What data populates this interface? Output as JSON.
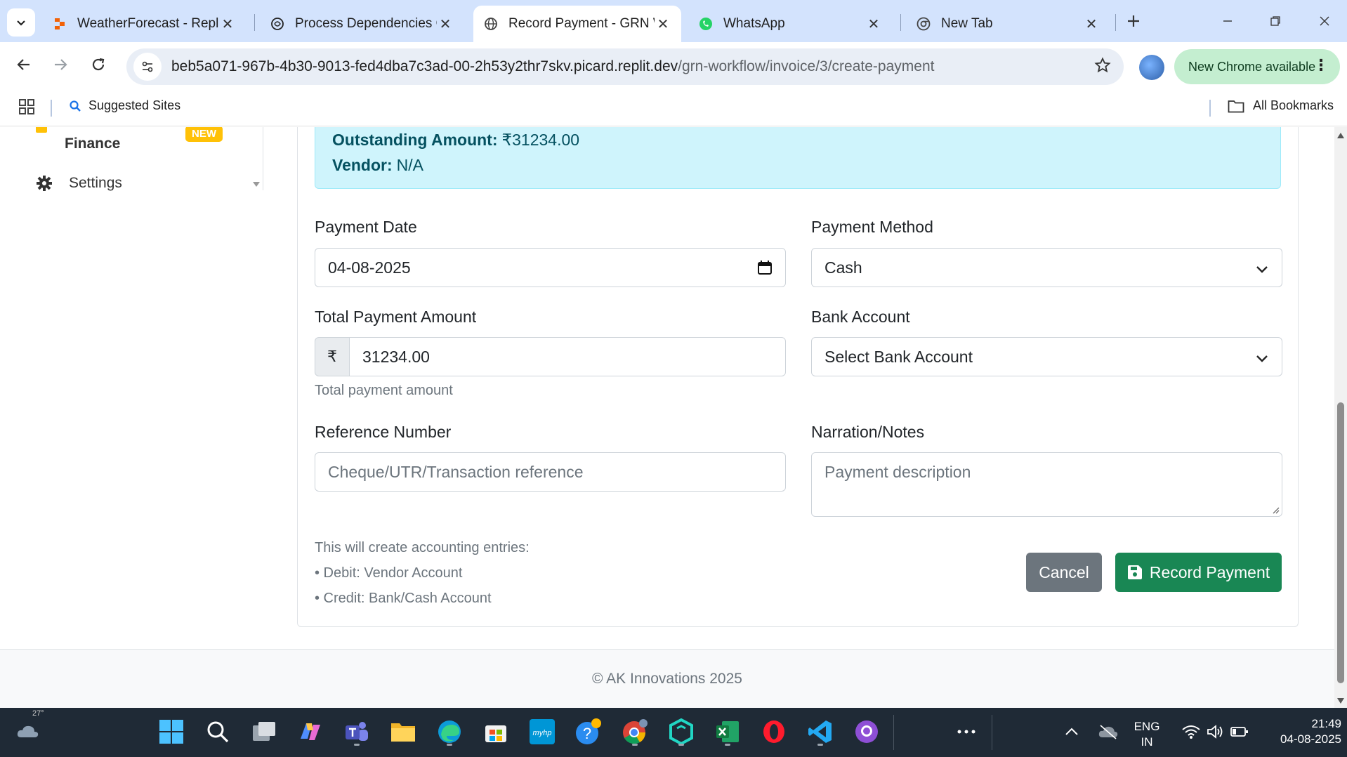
{
  "browser": {
    "tabs": [
      {
        "title": "WeatherForecast - Replit",
        "icon": "replit-icon",
        "active": false
      },
      {
        "title": "Process Dependencies O",
        "icon": "chatgpt-icon",
        "active": false
      },
      {
        "title": "Record Payment - GRN W",
        "icon": "globe-icon",
        "active": true
      },
      {
        "title": "WhatsApp",
        "icon": "whatsapp-icon",
        "active": false
      },
      {
        "title": "New Tab",
        "icon": "chrome-icon",
        "active": false
      }
    ],
    "url_host": "beb5a071-967b-4b30-9013-fed4dba7c3ad-00-2h53y2thr7skv.picard.replit.dev",
    "url_path": "/grn-workflow/invoice/3/create-payment",
    "update_label": "New Chrome available",
    "bookmarks": {
      "suggested_sites": "Suggested Sites",
      "all_bookmarks": "All Bookmarks"
    }
  },
  "sidebar": {
    "finance_label": "Finance",
    "new_badge": "NEW",
    "settings_label": "Settings"
  },
  "info": {
    "outstanding_label": "Outstanding Amount:",
    "outstanding_value": "₹31234.00",
    "vendor_label": "Vendor:",
    "vendor_value": "N/A"
  },
  "form": {
    "payment_date_label": "Payment Date",
    "payment_date_value": "04-08-2025",
    "payment_method_label": "Payment Method",
    "payment_method_value": "Cash",
    "total_amount_label": "Total Payment Amount",
    "currency_symbol": "₹",
    "total_amount_value": "31234.00",
    "total_amount_help": "Total payment amount",
    "bank_account_label": "Bank Account",
    "bank_account_value": "Select Bank Account",
    "reference_label": "Reference Number",
    "reference_placeholder": "Cheque/UTR/Transaction reference",
    "narration_label": "Narration/Notes",
    "narration_placeholder": "Payment description",
    "note_line1": "This will create accounting entries:",
    "note_line2": "• Debit: Vendor Account",
    "note_line3": "• Credit: Bank/Cash Account",
    "cancel_label": "Cancel",
    "record_label": "Record Payment"
  },
  "footer": {
    "copyright": "© AK Innovations 2025"
  },
  "taskbar": {
    "weather_temp": "27°",
    "lang_line1": "ENG",
    "lang_line2": "IN",
    "time": "21:49",
    "date": "04-08-2025"
  },
  "colors": {
    "primary_green": "#198754",
    "secondary_gray": "#6c757d",
    "info_bg": "#cff4fc",
    "info_text": "#055160",
    "badge_yellow": "#ffc107"
  }
}
